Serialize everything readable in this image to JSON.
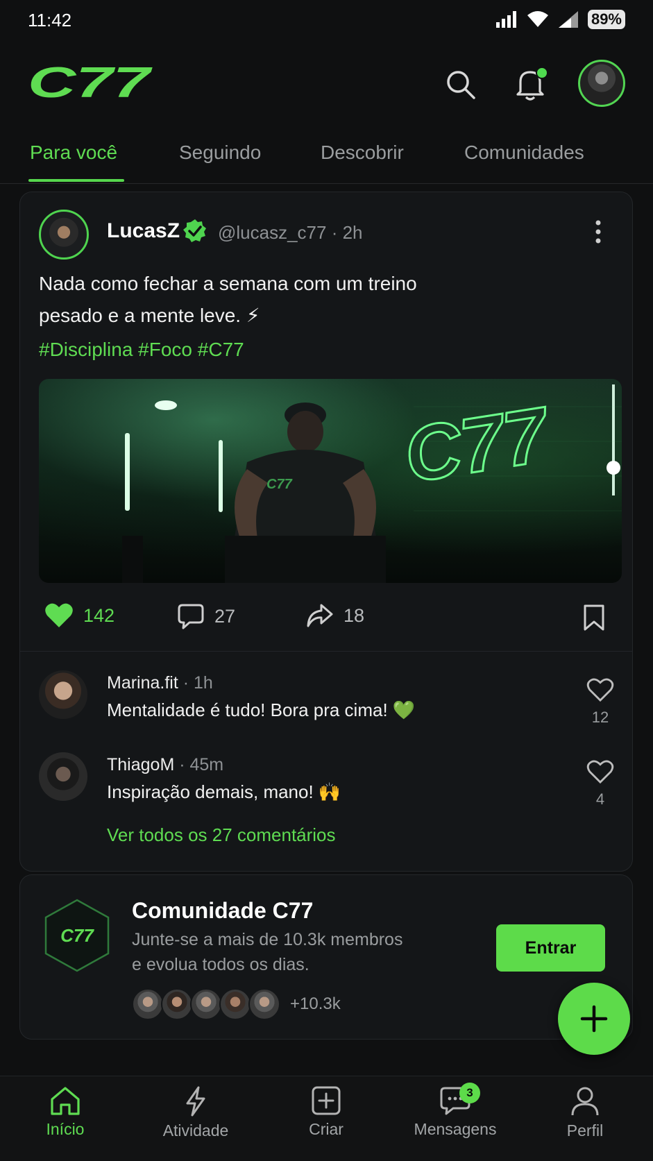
{
  "status_bar": {
    "time": "11:42",
    "battery": "89%"
  },
  "header": {
    "logo_text": "C77"
  },
  "tabs": [
    {
      "label": "Para você",
      "active": true
    },
    {
      "label": "Seguindo"
    },
    {
      "label": "Descobrir"
    },
    {
      "label": "Comunidades"
    }
  ],
  "post": {
    "author": "LucasZ",
    "meta": "@lucasz_c77 · 2h",
    "text_line1": "Nada como fechar a semana com um treino",
    "text_line2": "pesado e a mente leve. ⚡",
    "hashtags": "#Disciplina #Foco #C77",
    "image_text": "C77",
    "likes": "142",
    "comments": "27",
    "shares": "18"
  },
  "comments": [
    {
      "name": "Marina.fit",
      "time": " · 1h",
      "text": "Mentalidade é tudo! Bora pra cima! 💚",
      "likes": "12"
    },
    {
      "name": "ThiagoM",
      "time": " · 45m",
      "text": "Inspiração demais, mano! 🙌",
      "likes": "4"
    }
  ],
  "view_all_comments": "Ver todos os 27 comentários",
  "community": {
    "logo_text": "C77",
    "title": "Comunidade C77",
    "desc_line1": "Junte-se a mais de 10.3k membros",
    "desc_line2": "e evolua todos os dias.",
    "member_count": "+10.3k",
    "join_label": "Entrar"
  },
  "bottom_nav": [
    {
      "label": "Início",
      "active": true
    },
    {
      "label": "Atividade"
    },
    {
      "label": "Criar"
    },
    {
      "label": "Mensagens",
      "badge": "3"
    },
    {
      "label": "Perfil"
    }
  ],
  "colors": {
    "accent": "#5ddb4a",
    "background": "#0f1011",
    "card": "#141618"
  }
}
